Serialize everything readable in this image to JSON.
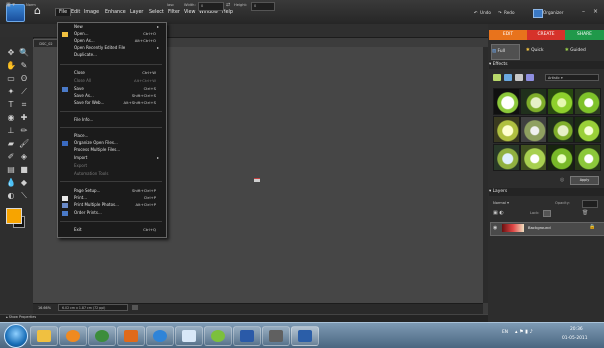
{
  "app": {
    "menus": [
      "File",
      "Edit",
      "Image",
      "Enhance",
      "Layer",
      "Select",
      "Filter",
      "View",
      "Window",
      "Help"
    ],
    "active_menu": "File",
    "top_right": {
      "undo": "Undo",
      "redo": "Redo",
      "organizer": "Organizer",
      "minimize": "–",
      "close": "×"
    }
  },
  "options_bar": {
    "mode": "Norm",
    "ratio_label": "lasc",
    "width_label": "Width:",
    "width_value": "0",
    "height_label": "Height:",
    "height_value": "0"
  },
  "document": {
    "tab": "DSC_02",
    "zoom": "16.66%",
    "size": "6.02 cm x 1.87 cm (72 ppi)"
  },
  "project_bin": {
    "label": "Show Properties"
  },
  "file_menu": {
    "items": [
      {
        "label": "New",
        "shortcut": "",
        "submenu": true,
        "disabled": false
      },
      {
        "label": "Open...",
        "shortcut": "Ctrl+O",
        "submenu": false,
        "disabled": false
      },
      {
        "label": "Open As...",
        "shortcut": "Alt+Ctrl+O",
        "submenu": false,
        "disabled": false
      },
      {
        "label": "Open Recently Edited File",
        "shortcut": "",
        "submenu": true,
        "disabled": false
      },
      {
        "label": "Duplicate...",
        "shortcut": "",
        "submenu": false,
        "disabled": false
      },
      {
        "label": "Close",
        "shortcut": "Ctrl+W",
        "submenu": false,
        "disabled": false
      },
      {
        "label": "Close All",
        "shortcut": "Alt+Ctrl+W",
        "submenu": false,
        "disabled": true
      },
      {
        "label": "Save",
        "shortcut": "Ctrl+S",
        "submenu": false,
        "disabled": false
      },
      {
        "label": "Save As...",
        "shortcut": "Shift+Ctrl+S",
        "submenu": false,
        "disabled": false
      },
      {
        "label": "Save for Web...",
        "shortcut": "Alt+Shift+Ctrl+S",
        "submenu": false,
        "disabled": false
      },
      {
        "label": "File Info...",
        "shortcut": "",
        "submenu": false,
        "disabled": false
      },
      {
        "label": "Place...",
        "shortcut": "",
        "submenu": false,
        "disabled": false
      },
      {
        "label": "Organize Open Files...",
        "shortcut": "",
        "submenu": false,
        "disabled": false
      },
      {
        "label": "Process Multiple Files...",
        "shortcut": "",
        "submenu": false,
        "disabled": false
      },
      {
        "label": "Import",
        "shortcut": "",
        "submenu": true,
        "disabled": false
      },
      {
        "label": "Export",
        "shortcut": "",
        "submenu": false,
        "disabled": true
      },
      {
        "label": "Automation Tools",
        "shortcut": "",
        "submenu": false,
        "disabled": true
      },
      {
        "label": "Page Setup...",
        "shortcut": "Shift+Ctrl+P",
        "submenu": false,
        "disabled": false
      },
      {
        "label": "Print...",
        "shortcut": "Ctrl+P",
        "submenu": false,
        "disabled": false
      },
      {
        "label": "Print Multiple Photos...",
        "shortcut": "Alt+Ctrl+P",
        "submenu": false,
        "disabled": false
      },
      {
        "label": "Order Prints...",
        "shortcut": "",
        "submenu": false,
        "disabled": false
      },
      {
        "label": "Exit",
        "shortcut": "Ctrl+Q",
        "submenu": false,
        "disabled": false
      }
    ]
  },
  "right_panel": {
    "modes": {
      "edit": "EDIT",
      "create": "CREATE",
      "share": "SHARE"
    },
    "subtabs": {
      "full": "Full",
      "quick": "Quick",
      "guided": "Guided"
    },
    "effects": {
      "title": "Effects",
      "category": "Artistic",
      "apply": "Apply"
    },
    "layers": {
      "title": "Layers",
      "blend_mode": "Normal",
      "opacity_label": "Opacity:",
      "lock_label": "Lock:",
      "layer_name": "Background"
    }
  },
  "taskbar": {
    "lang": "EN",
    "time": "20:36",
    "date": "01-05-2011"
  },
  "colors": {
    "foreground": "#f7a400",
    "background": "#111111",
    "edit": "#e8731c",
    "create": "#d6322a",
    "share": "#20994a"
  }
}
